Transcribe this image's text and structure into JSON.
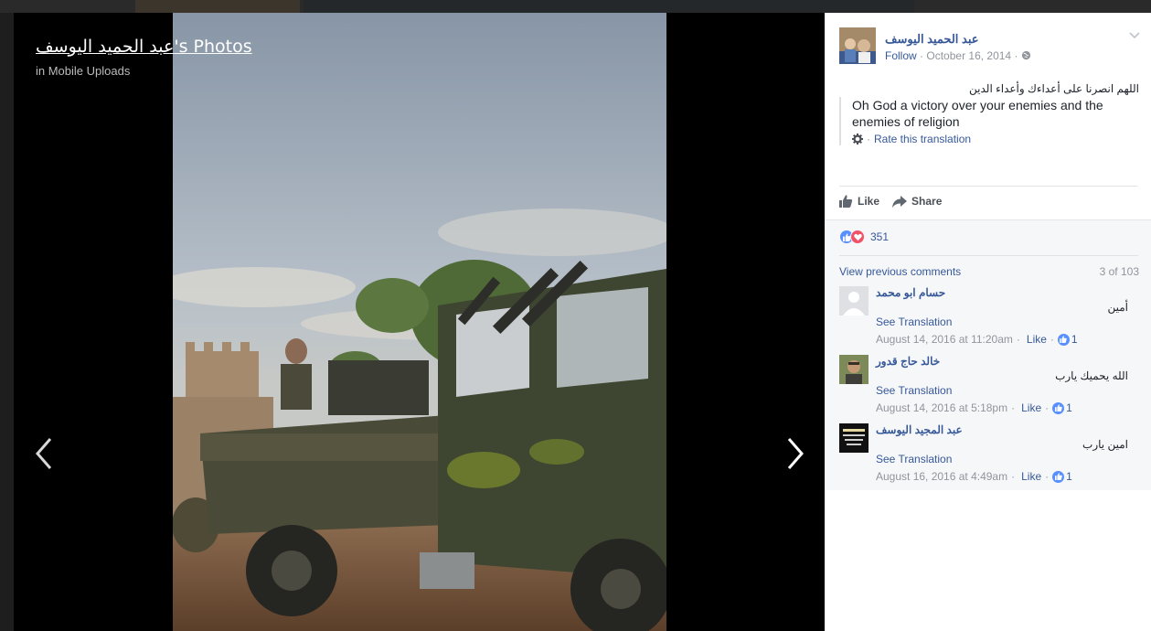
{
  "theater": {
    "title": "عبد الحميد اليوسف's Photos",
    "subtitle": "in Mobile Uploads"
  },
  "post": {
    "author": "عبد الحميد اليوسف",
    "follow_label": "Follow",
    "date": "October 16, 2014",
    "original_text": "اللهم انصرنا على أعداءك وأعداء الدين",
    "translation": "Oh God a victory over your enemies and the enemies of religion",
    "rate_label": "Rate this translation"
  },
  "actions": {
    "like": "Like",
    "share": "Share"
  },
  "reactions": {
    "count": "351"
  },
  "comments_section": {
    "view_previous": "View previous comments",
    "count": "3 of 103",
    "items": [
      {
        "author": "حسام ابو محمد",
        "text": "أمين",
        "see_translation": "See Translation",
        "date": "August 14, 2016 at 11:20am",
        "like": "Like",
        "likes": "1"
      },
      {
        "author": "خالد حاج قدور",
        "text": "الله يحميك يارب",
        "see_translation": "See Translation",
        "date": "August 14, 2016 at 5:18pm",
        "like": "Like",
        "likes": "1"
      },
      {
        "author": "عبد المجيد اليوسف",
        "text": "امين يارب",
        "see_translation": "See Translation",
        "date": "August 16, 2016 at 4:49am",
        "like": "Like",
        "likes": "1"
      }
    ]
  },
  "icons": [
    "chevron-left-icon",
    "chevron-right-icon",
    "globe-icon",
    "chevron-down-icon",
    "gear-icon",
    "thumbs-up-icon",
    "share-arrow-icon",
    "heart-icon"
  ],
  "colors": {
    "link": "#365899",
    "muted": "#90949c",
    "like_blue": "#5890ff",
    "love_red": "#f25268"
  }
}
